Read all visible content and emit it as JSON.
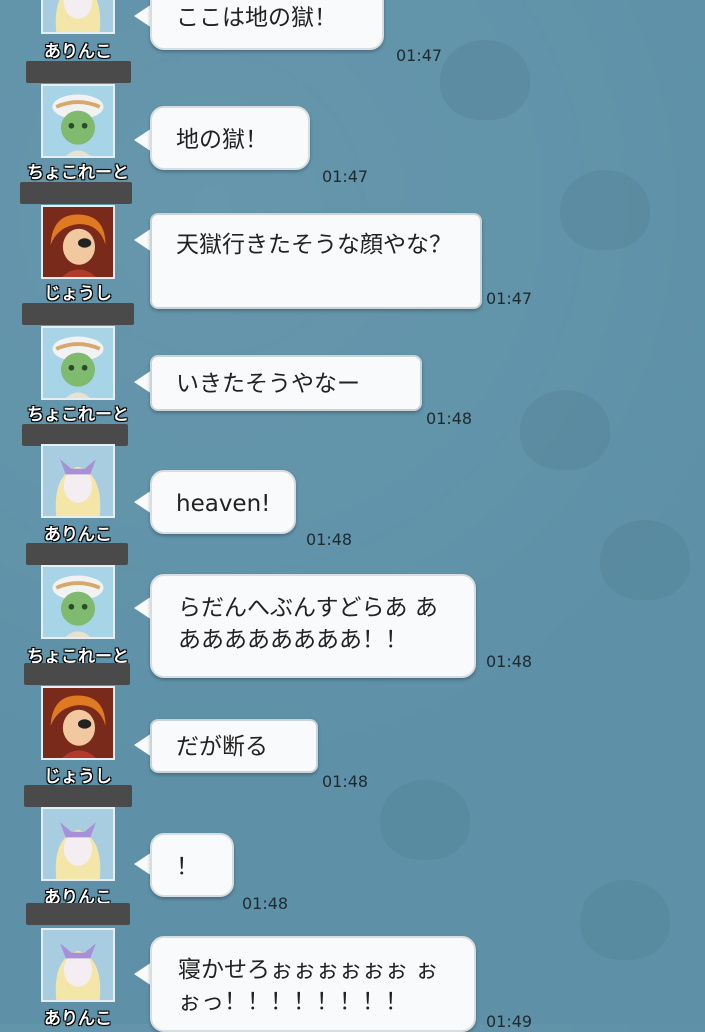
{
  "messages": [
    {
      "name": "ありんこ",
      "text": "ここは地の獄！",
      "time": "01:47",
      "avatar": "arinko-icon",
      "style": "spiky"
    },
    {
      "name": "ちょこれーと",
      "text": "地の獄！",
      "time": "01:47",
      "avatar": "chocolate-icon",
      "style": "spiky"
    },
    {
      "name": "じょうし",
      "text": "天獄行きたそうな顔やな？",
      "time": "01:47",
      "avatar": "joushi-icon",
      "style": "normal"
    },
    {
      "name": "ちょこれーと",
      "text": "いきたそうやなー",
      "time": "01:48",
      "avatar": "chocolate-icon",
      "style": "normal"
    },
    {
      "name": "ありんこ",
      "text": "heaven!",
      "time": "01:48",
      "avatar": "arinko-icon",
      "style": "spiky"
    },
    {
      "name": "ちょこれーと",
      "text": "らだんへぶんすどらあ あああああああああ！！",
      "time": "01:48",
      "avatar": "chocolate-icon",
      "style": "spiky"
    },
    {
      "name": "じょうし",
      "text": "だが断る",
      "time": "01:48",
      "avatar": "joushi-icon",
      "style": "normal"
    },
    {
      "name": "ありんこ",
      "text": "！",
      "time": "01:48",
      "avatar": "arinko-icon",
      "style": "spiky"
    },
    {
      "name": "ありんこ",
      "text": "寝かせろぉぉぉぉぉぉ ぉぉっ！！！！！！！！",
      "time": "01:49",
      "avatar": "arinko-icon",
      "style": "spiky"
    }
  ],
  "colors": {
    "background": "#5e91a8",
    "bubble": "#f8fafb",
    "name_text": "#ffffff",
    "redaction": "#4a4a4a"
  }
}
